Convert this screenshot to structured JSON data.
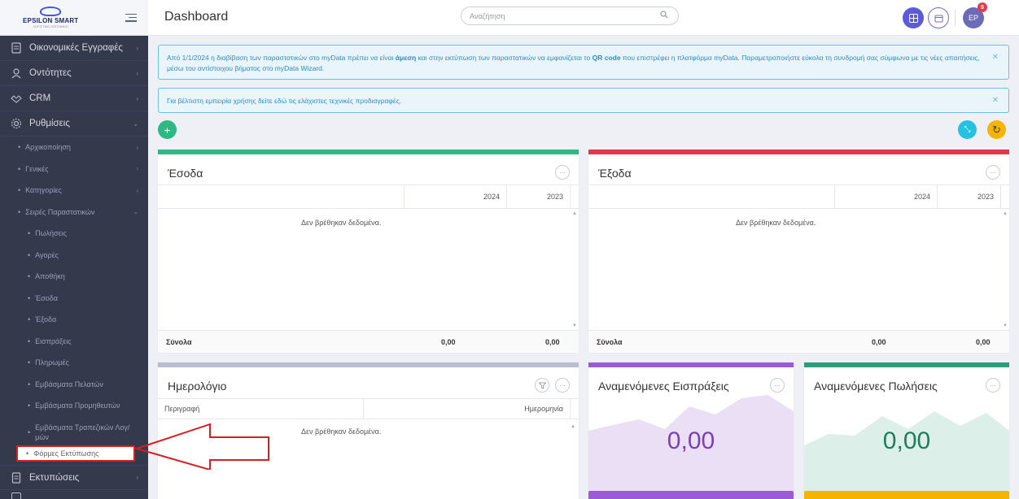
{
  "sidebar": {
    "logo_text": "EPSILON SMART",
    "logo_sub": "ΛΟΓΙΣΤΙΚΟ ΛΟΓΙΣΜΙΚΟ",
    "main_items": [
      {
        "label": "Οικονομικές Εγγραφές",
        "icon": "ledger-icon"
      },
      {
        "label": "Οντότητες",
        "icon": "users-icon"
      },
      {
        "label": "CRM",
        "icon": "handshake-icon"
      },
      {
        "label": "Ρυθμίσεις",
        "icon": "gear-icon"
      }
    ],
    "settings_items": [
      "Αρχικοποίηση",
      "Γενικές",
      "Κατηγορίες",
      "Σειρές Παραστατικών"
    ],
    "series_items": [
      "Πωλήσεις",
      "Αγορές",
      "Αποθήκη",
      "Έσοδα",
      "Έξοδα",
      "Εισπράξεις",
      "Πληρωμές",
      "Εμβάσματα Πελατών",
      "Εμβάσματα Προμηθευτών",
      "Εμβάσματα Τραπεζικών Λογ/μών"
    ],
    "highlighted_item": "Φόρμες Εκτύπωσης",
    "printouts_label": "Εκτυπώσεις"
  },
  "topbar": {
    "title": "Dashboard",
    "search_placeholder": "Αναζήτηση",
    "user_initials": "EP",
    "notification_count": "5"
  },
  "alerts": {
    "mydata_part1": "Από 1/1/2024 η διαβίβαση των παραστατικών στο myData πρέπει να είναι ",
    "mydata_bold1": "άμεση",
    "mydata_part2": " και στην εκτύπωση των παραστατικών να εμφανίζεται το ",
    "mydata_bold2": "QR code",
    "mydata_part3": " που επιστρέφει η πλατφόρμα myData. Παραμετροποιήστε εύκολα τη συνδρομή σας σύμφωνα με τις νέες απαιτήσεις, μέσω του αντίστοιχου βήματος στο myData Wizard.",
    "specs": "Για βέλτιστη εμπειρία χρήσης δείτε εδώ τις ελάχιστες τεχνικές προδιαγραφές."
  },
  "income_card": {
    "title": "Έσοδα",
    "col_2024": "2024",
    "col_2023": "2023",
    "empty": "Δεν βρέθηκαν δεδομένα.",
    "totals_label": "Σύνολα",
    "total_2024": "0,00",
    "total_2023": "0,00"
  },
  "expenses_card": {
    "title": "Έξοδα",
    "col_2024": "2024",
    "col_2023": "2023",
    "empty": "Δεν βρέθηκαν δεδομένα.",
    "totals_label": "Σύνολα",
    "total_2024": "0,00",
    "total_2023": "0,00"
  },
  "calendar_card": {
    "title": "Ημερολόγιο",
    "col_desc": "Περιγραφή",
    "col_date": "Ημερομηνία",
    "empty": "Δεν βρέθηκαν δεδομένα."
  },
  "receipts_card": {
    "title": "Αναμενόμενες Εισπράξεις",
    "value": "0,00"
  },
  "sales_card": {
    "title": "Αναμενόμενες Πωλήσεις",
    "value": "0,00"
  },
  "colors": {
    "income": "#2fb884",
    "expenses": "#e5364a",
    "calendar": "#b8bdd0",
    "receipts": "#9b5ad6",
    "sales": "#2a9d7a",
    "arrow": "#d42020"
  }
}
